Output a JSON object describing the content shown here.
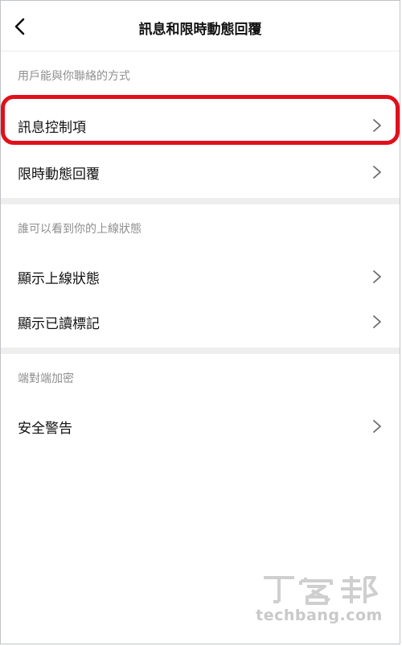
{
  "header": {
    "title": "訊息和限時動態回覆",
    "back_icon": "chevron-left-icon"
  },
  "sections": [
    {
      "label": "用戶能與你聯絡的方式",
      "items": [
        {
          "label": "訊息控制項",
          "icon": "chevron-right-icon",
          "highlighted": true
        },
        {
          "label": "限時動態回覆",
          "icon": "chevron-right-icon"
        }
      ]
    },
    {
      "label": "誰可以看到你的上線狀態",
      "items": [
        {
          "label": "顯示上線狀態",
          "icon": "chevron-right-icon"
        },
        {
          "label": "顯示已讀標記",
          "icon": "chevron-right-icon"
        }
      ]
    },
    {
      "label": "端對端加密",
      "items": [
        {
          "label": "安全警告",
          "icon": "chevron-right-icon"
        }
      ]
    }
  ],
  "watermark": {
    "logo_text": "T客邦",
    "domain": "techbang.com"
  },
  "colors": {
    "highlight": "#e0101b",
    "section_label": "#8f8f8f",
    "divider": "#eeeeee"
  }
}
